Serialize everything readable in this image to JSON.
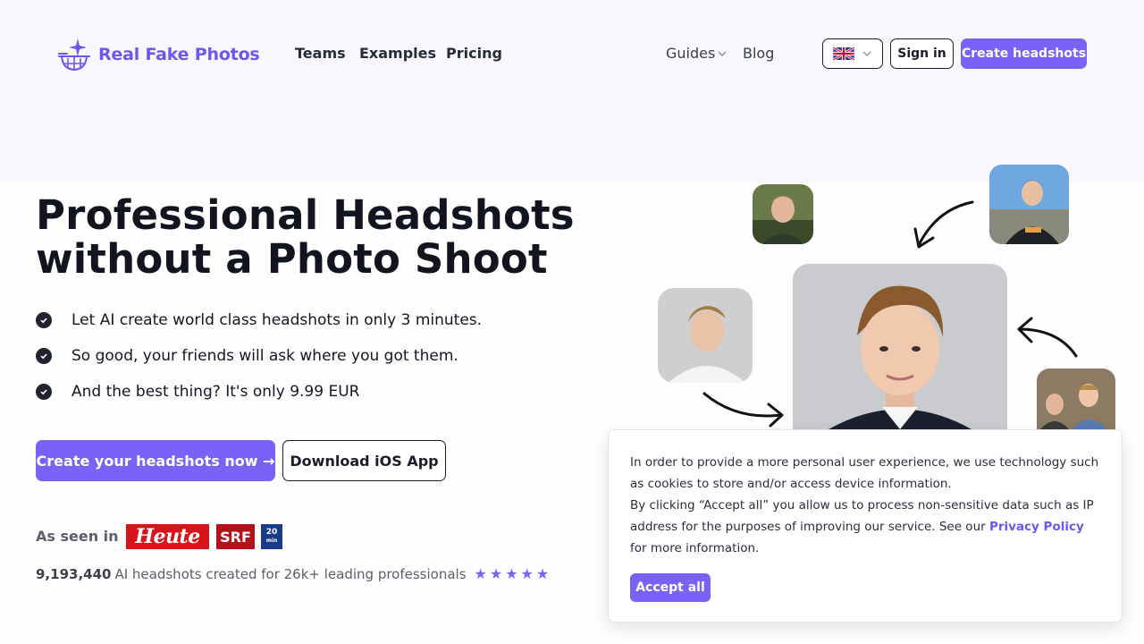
{
  "header": {
    "brand": "Real Fake Photos",
    "nav": [
      "Teams",
      "Examples",
      "Pricing"
    ],
    "guides": "Guides",
    "blog": "Blog",
    "signin": "Sign in",
    "cta": "Create headshots"
  },
  "hero": {
    "title_line1": "Professional Headshots",
    "title_line2": "without a Photo Shoot",
    "bullets": [
      "Let AI create world class headshots in only 3 minutes.",
      "So good, your friends will ask where you got them.",
      "And the best thing? It's only 9.99 EUR"
    ],
    "cta_primary": "Create your headshots now →",
    "cta_secondary": "Download iOS App",
    "seen_in": "As seen in",
    "press": {
      "heute": "Heute",
      "srf": "SRF",
      "twenty_top": "20",
      "twenty_bottom": "min"
    },
    "stats_count": "9,193,440",
    "stats_text": "AI headshots created for 26k+ leading professionals",
    "rating": 5
  },
  "cookie": {
    "line1": "In order to provide a more personal user experience, we use technology such as cookies to store and/or access device information.",
    "line2_pre": "By clicking “Accept all” you allow us to process non-sensitive data such as IP address for the purposes of improving our service. See our ",
    "privacy_link": "Privacy Policy",
    "line2_post": " for more information.",
    "accept": "Accept all"
  },
  "colors": {
    "accent": "#7b61f5",
    "text": "#121420",
    "heute_red": "#d8141b",
    "srf_red": "#b5111a"
  },
  "icons": [
    "sparkle-camera-logo-icon",
    "uk-flag-icon",
    "chevron-down-icon",
    "check-circle-icon",
    "star-icon",
    "curved-arrow-icon"
  ]
}
